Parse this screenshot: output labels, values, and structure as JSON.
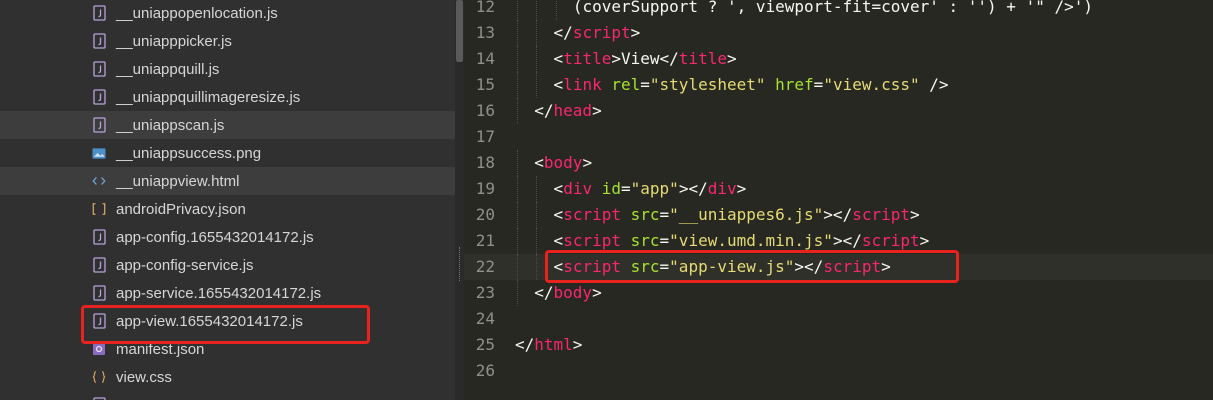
{
  "file_tree": {
    "files": [
      {
        "name": "__uniappopenlocation.js",
        "icon": "js-file-icon",
        "selected": false
      },
      {
        "name": "__uniapppicker.js",
        "icon": "js-file-icon",
        "selected": false
      },
      {
        "name": "__uniappquill.js",
        "icon": "js-file-icon",
        "selected": false
      },
      {
        "name": "__uniappquillimageresize.js",
        "icon": "js-file-icon",
        "selected": false
      },
      {
        "name": "__uniappscan.js",
        "icon": "js-file-icon",
        "selected": true
      },
      {
        "name": "__uniappsuccess.png",
        "icon": "image-file-icon",
        "selected": false
      },
      {
        "name": "__uniappview.html",
        "icon": "html-file-icon",
        "selected": true
      },
      {
        "name": "androidPrivacy.json",
        "icon": "json-file-icon",
        "selected": false
      },
      {
        "name": "app-config.1655432014172.js",
        "icon": "js-file-icon",
        "selected": false
      },
      {
        "name": "app-config-service.js",
        "icon": "js-file-icon",
        "selected": false
      },
      {
        "name": "app-service.1655432014172.js",
        "icon": "js-file-icon",
        "selected": false
      },
      {
        "name": "app-view.1655432014172.js",
        "icon": "js-file-icon",
        "selected": false
      },
      {
        "name": "manifest.json",
        "icon": "manifest-file-icon",
        "selected": false
      },
      {
        "name": "view.css",
        "icon": "css-file-icon",
        "selected": false
      },
      {
        "name": "",
        "icon": "js-file-icon",
        "selected": false
      }
    ]
  },
  "editor": {
    "lines": [
      {
        "num": "12",
        "indent": 3,
        "tokens": [
          {
            "t": "op",
            "v": "(coverSupport ? ', viewport-fit=cover' : '') + '\" />')"
          }
        ]
      },
      {
        "num": "13",
        "indent": 2,
        "tokens": [
          {
            "t": "op",
            "v": "</"
          },
          {
            "t": "tag",
            "v": "script"
          },
          {
            "t": "op",
            "v": ">"
          }
        ]
      },
      {
        "num": "14",
        "indent": 2,
        "tokens": [
          {
            "t": "op",
            "v": "<"
          },
          {
            "t": "tag",
            "v": "title"
          },
          {
            "t": "op",
            "v": ">View</"
          },
          {
            "t": "tag",
            "v": "title"
          },
          {
            "t": "op",
            "v": ">"
          }
        ]
      },
      {
        "num": "15",
        "indent": 2,
        "tokens": [
          {
            "t": "op",
            "v": "<"
          },
          {
            "t": "tag",
            "v": "link"
          },
          {
            "t": "op",
            "v": " "
          },
          {
            "t": "attr",
            "v": "rel"
          },
          {
            "t": "op",
            "v": "="
          },
          {
            "t": "str",
            "v": "\"stylesheet\""
          },
          {
            "t": "op",
            "v": " "
          },
          {
            "t": "attr",
            "v": "href"
          },
          {
            "t": "op",
            "v": "="
          },
          {
            "t": "str",
            "v": "\"view.css\""
          },
          {
            "t": "op",
            "v": " />"
          }
        ]
      },
      {
        "num": "16",
        "indent": 1,
        "tokens": [
          {
            "t": "op",
            "v": "</"
          },
          {
            "t": "tag",
            "v": "head"
          },
          {
            "t": "op",
            "v": ">"
          }
        ]
      },
      {
        "num": "17",
        "indent": 0,
        "tokens": []
      },
      {
        "num": "18",
        "indent": 1,
        "tokens": [
          {
            "t": "op",
            "v": "<"
          },
          {
            "t": "tag",
            "v": "body"
          },
          {
            "t": "op",
            "v": ">"
          }
        ]
      },
      {
        "num": "19",
        "indent": 2,
        "tokens": [
          {
            "t": "op",
            "v": "<"
          },
          {
            "t": "tag",
            "v": "div"
          },
          {
            "t": "op",
            "v": " "
          },
          {
            "t": "attr",
            "v": "id"
          },
          {
            "t": "op",
            "v": "="
          },
          {
            "t": "str",
            "v": "\"app\""
          },
          {
            "t": "op",
            "v": "></"
          },
          {
            "t": "tag",
            "v": "div"
          },
          {
            "t": "op",
            "v": ">"
          }
        ]
      },
      {
        "num": "20",
        "indent": 2,
        "tokens": [
          {
            "t": "op",
            "v": "<"
          },
          {
            "t": "tag",
            "v": "script"
          },
          {
            "t": "op",
            "v": " "
          },
          {
            "t": "attr",
            "v": "src"
          },
          {
            "t": "op",
            "v": "="
          },
          {
            "t": "str",
            "v": "\"__uniappes6.js\""
          },
          {
            "t": "op",
            "v": "></"
          },
          {
            "t": "tag",
            "v": "script"
          },
          {
            "t": "op",
            "v": ">"
          }
        ]
      },
      {
        "num": "21",
        "indent": 2,
        "tokens": [
          {
            "t": "op",
            "v": "<"
          },
          {
            "t": "tag",
            "v": "script"
          },
          {
            "t": "op",
            "v": " "
          },
          {
            "t": "attr",
            "v": "src"
          },
          {
            "t": "op",
            "v": "="
          },
          {
            "t": "str",
            "v": "\"view.umd.min.js\""
          },
          {
            "t": "op",
            "v": "></"
          },
          {
            "t": "tag",
            "v": "script"
          },
          {
            "t": "op",
            "v": ">"
          }
        ]
      },
      {
        "num": "22",
        "indent": 2,
        "active": true,
        "tokens": [
          {
            "t": "op",
            "v": "<"
          },
          {
            "t": "tag",
            "v": "script"
          },
          {
            "t": "op",
            "v": " "
          },
          {
            "t": "attr",
            "v": "src"
          },
          {
            "t": "op",
            "v": "="
          },
          {
            "t": "str",
            "v": "\"app-view.js\""
          },
          {
            "t": "op",
            "v": "></"
          },
          {
            "t": "tag",
            "v": "script"
          },
          {
            "t": "op",
            "v": ">"
          }
        ]
      },
      {
        "num": "23",
        "indent": 1,
        "tokens": [
          {
            "t": "op",
            "v": "</"
          },
          {
            "t": "tag",
            "v": "body"
          },
          {
            "t": "op",
            "v": ">"
          }
        ]
      },
      {
        "num": "24",
        "indent": 0,
        "tokens": []
      },
      {
        "num": "25",
        "indent": 0,
        "tokens": [
          {
            "t": "op",
            "v": "</"
          },
          {
            "t": "tag",
            "v": "html"
          },
          {
            "t": "op",
            "v": ">"
          }
        ]
      },
      {
        "num": "26",
        "indent": 0,
        "tokens": []
      }
    ]
  },
  "colors": {
    "tag": "#f92672",
    "attr": "#a6e22e",
    "string": "#e6db74",
    "annotation": "#e8221c"
  }
}
